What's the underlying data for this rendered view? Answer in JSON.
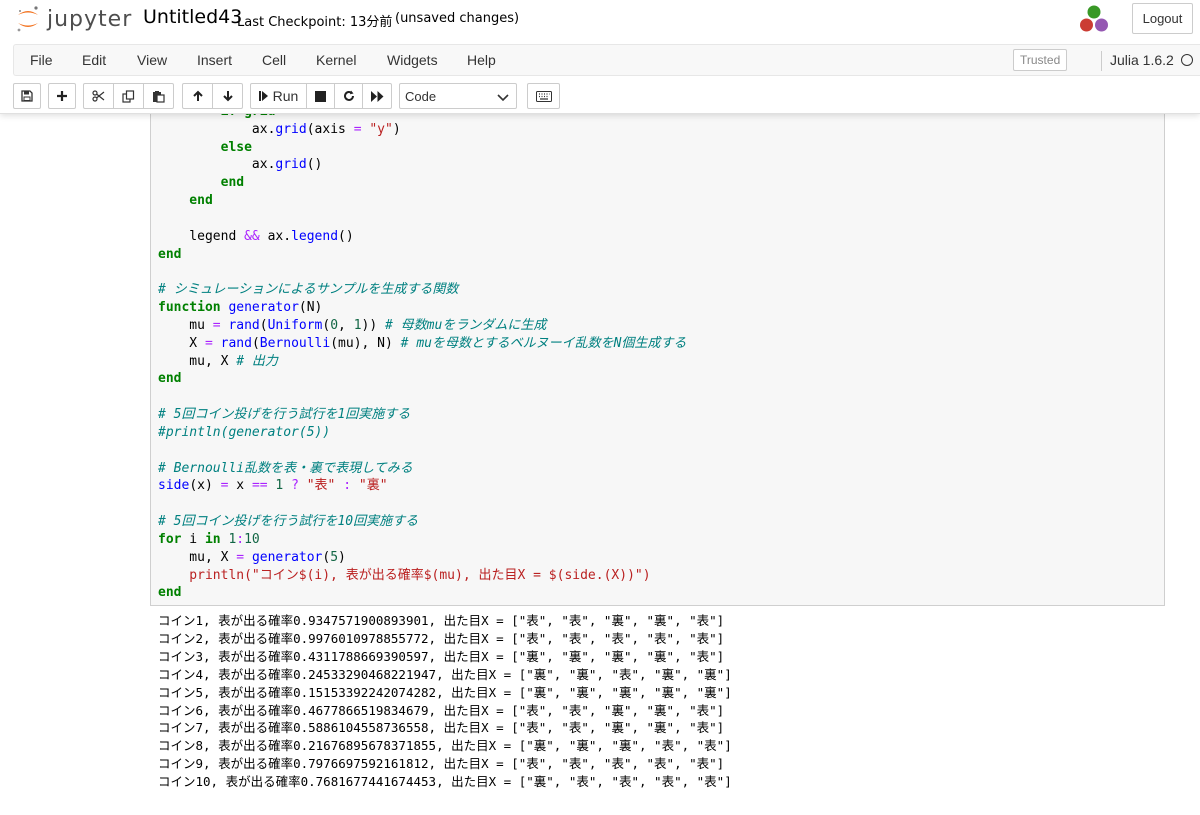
{
  "header": {
    "logo_text": "jupyter",
    "notebook_name": "Untitled43",
    "checkpoint": "Last Checkpoint: 13分前",
    "autosave": "(unsaved changes)",
    "logout_label": "Logout"
  },
  "menubar": {
    "items": [
      "File",
      "Edit",
      "View",
      "Insert",
      "Cell",
      "Kernel",
      "Widgets",
      "Help"
    ],
    "trusted_label": "Trusted",
    "kernel_name": "Julia 1.6.2"
  },
  "toolbar": {
    "run_label": "Run",
    "cell_type": "Code",
    "icons": [
      "save-icon",
      "plus-icon",
      "scissors-icon",
      "copy-icon",
      "paste-icon",
      "arrow-up-icon",
      "arrow-down-icon",
      "step-forward-icon",
      "stop-icon",
      "restart-icon",
      "fast-forward-icon",
      "chevron-down-icon",
      "keyboard-icon"
    ]
  },
  "colors": {
    "keyword": "#008000",
    "function": "#0000ff",
    "operator": "#aa22ff",
    "number": "#116644",
    "string": "#ba2121",
    "comment": "#008080",
    "logo_orange": "#f37726",
    "julia_green": "#389826",
    "julia_red": "#cb3c33",
    "julia_purple": "#9558b2"
  },
  "code": [
    [
      {
        "t": "        if grid",
        "c": "kw"
      }
    ],
    [
      {
        "t": "            ax.",
        "c": ""
      },
      {
        "t": "grid",
        "c": "fn"
      },
      {
        "t": "(axis ",
        "c": ""
      },
      {
        "t": "=",
        "c": "op"
      },
      {
        "t": " \"y\"",
        "c": "str"
      },
      {
        "t": ")",
        "c": ""
      }
    ],
    [
      {
        "t": "        else",
        "c": "kw"
      }
    ],
    [
      {
        "t": "            ax.",
        "c": ""
      },
      {
        "t": "grid",
        "c": "fn"
      },
      {
        "t": "()",
        "c": ""
      }
    ],
    [
      {
        "t": "        end",
        "c": "kw"
      }
    ],
    [
      {
        "t": "    end",
        "c": "kw"
      }
    ],
    [],
    [
      {
        "t": "    legend ",
        "c": ""
      },
      {
        "t": "&&",
        "c": "op"
      },
      {
        "t": " ax.",
        "c": ""
      },
      {
        "t": "legend",
        "c": "fn"
      },
      {
        "t": "()",
        "c": ""
      }
    ],
    [
      {
        "t": "end",
        "c": "kw"
      }
    ],
    [],
    [
      {
        "t": "# シミュレーションによるサンプルを生成する関数",
        "c": "cm"
      }
    ],
    [
      {
        "t": "function ",
        "c": "kw"
      },
      {
        "t": "generator",
        "c": "fn"
      },
      {
        "t": "(N)",
        "c": ""
      }
    ],
    [
      {
        "t": "    mu ",
        "c": ""
      },
      {
        "t": "=",
        "c": "op"
      },
      {
        "t": " ",
        "c": ""
      },
      {
        "t": "rand",
        "c": "fn"
      },
      {
        "t": "(",
        "c": ""
      },
      {
        "t": "Uniform",
        "c": "fn"
      },
      {
        "t": "(",
        "c": ""
      },
      {
        "t": "0",
        "c": "num"
      },
      {
        "t": ", ",
        "c": ""
      },
      {
        "t": "1",
        "c": "num"
      },
      {
        "t": ")) ",
        "c": ""
      },
      {
        "t": "# 母数muをランダムに生成",
        "c": "cm"
      }
    ],
    [
      {
        "t": "    X ",
        "c": ""
      },
      {
        "t": "=",
        "c": "op"
      },
      {
        "t": " ",
        "c": ""
      },
      {
        "t": "rand",
        "c": "fn"
      },
      {
        "t": "(",
        "c": ""
      },
      {
        "t": "Bernoulli",
        "c": "fn"
      },
      {
        "t": "(mu), N) ",
        "c": ""
      },
      {
        "t": "# muを母数とするベルヌーイ乱数をN個生成する",
        "c": "cm"
      }
    ],
    [
      {
        "t": "    mu, X ",
        "c": ""
      },
      {
        "t": "# 出力",
        "c": "cm"
      }
    ],
    [
      {
        "t": "end",
        "c": "kw"
      }
    ],
    [],
    [
      {
        "t": "# 5回コイン投げを行う試行を1回実施する",
        "c": "cm"
      }
    ],
    [
      {
        "t": "#println(generator(5))",
        "c": "cm"
      }
    ],
    [],
    [
      {
        "t": "# Bernoulli乱数を表・裏で表現してみる",
        "c": "cm"
      }
    ],
    [
      {
        "t": "side",
        "c": "fn"
      },
      {
        "t": "(x) ",
        "c": ""
      },
      {
        "t": "=",
        "c": "op"
      },
      {
        "t": " x ",
        "c": ""
      },
      {
        "t": "==",
        "c": "op"
      },
      {
        "t": " ",
        "c": ""
      },
      {
        "t": "1",
        "c": "num"
      },
      {
        "t": " ",
        "c": ""
      },
      {
        "t": "?",
        "c": "op"
      },
      {
        "t": " ",
        "c": ""
      },
      {
        "t": "\"表\"",
        "c": "str"
      },
      {
        "t": " ",
        "c": ""
      },
      {
        "t": ":",
        "c": "op"
      },
      {
        "t": " ",
        "c": ""
      },
      {
        "t": "\"裏\"",
        "c": "str"
      }
    ],
    [],
    [
      {
        "t": "# 5回コイン投げを行う試行を10回実施する",
        "c": "cm"
      }
    ],
    [
      {
        "t": "for",
        "c": "kw"
      },
      {
        "t": " i ",
        "c": ""
      },
      {
        "t": "in",
        "c": "kw"
      },
      {
        "t": " ",
        "c": ""
      },
      {
        "t": "1",
        "c": "num"
      },
      {
        "t": ":",
        "c": "op"
      },
      {
        "t": "10",
        "c": "num"
      }
    ],
    [
      {
        "t": "    mu, X ",
        "c": ""
      },
      {
        "t": "=",
        "c": "op"
      },
      {
        "t": " ",
        "c": ""
      },
      {
        "t": "generator",
        "c": "fn"
      },
      {
        "t": "(",
        "c": ""
      },
      {
        "t": "5",
        "c": "num"
      },
      {
        "t": ")",
        "c": ""
      }
    ],
    [
      {
        "t": "    println(\"コイン$(i), 表が出る確率$(mu), 出た目X = $(side.(X))\")",
        "c": "str"
      }
    ],
    [
      {
        "t": "end",
        "c": "kw"
      }
    ]
  ],
  "output": [
    "コイン1, 表が出る確率0.9347571900893901, 出た目X = [\"表\", \"表\", \"裏\", \"裏\", \"表\"]",
    "コイン2, 表が出る確率0.9976010978855772, 出た目X = [\"表\", \"表\", \"表\", \"表\", \"表\"]",
    "コイン3, 表が出る確率0.4311788669390597, 出た目X = [\"裏\", \"裏\", \"裏\", \"裏\", \"表\"]",
    "コイン4, 表が出る確率0.24533290468221947, 出た目X = [\"裏\", \"裏\", \"表\", \"裏\", \"裏\"]",
    "コイン5, 表が出る確率0.15153392242074282, 出た目X = [\"裏\", \"裏\", \"裏\", \"裏\", \"裏\"]",
    "コイン6, 表が出る確率0.4677866519834679, 出た目X = [\"表\", \"表\", \"裏\", \"裏\", \"表\"]",
    "コイン7, 表が出る確率0.5886104558736558, 出た目X = [\"表\", \"表\", \"裏\", \"裏\", \"表\"]",
    "コイン8, 表が出る確率0.21676895678371855, 出た目X = [\"裏\", \"裏\", \"裏\", \"表\", \"表\"]",
    "コイン9, 表が出る確率0.7976697592161812, 出た目X = [\"表\", \"表\", \"表\", \"表\", \"表\"]",
    "コイン10, 表が出る確率0.7681677441674453, 出た目X = [\"裏\", \"表\", \"表\", \"表\", \"表\"]"
  ]
}
